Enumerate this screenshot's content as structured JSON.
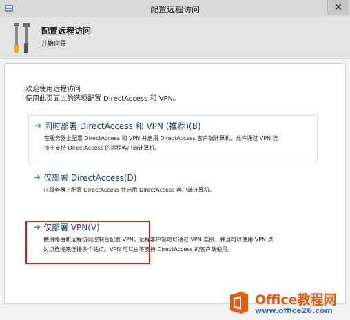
{
  "window": {
    "title": "配置远程访问"
  },
  "header": {
    "title": "配置远程访问",
    "subtitle": "开始向导"
  },
  "intro": {
    "line1": "欢迎使用远程访问",
    "line2": "使用此页面上的选项配置 DirectAccess 和 VPN。"
  },
  "options": [
    {
      "title": "同时部署 DirectAccess 和 VPN (推荐)(B)",
      "desc_line1": "在服务器上配置 DirectAccess 和 VPN 并启用 DirectAccess 客户端计算机。允许通过 VPN 连",
      "desc_line2": "接不支持 DirectAccess 的远程客户端计算机。"
    },
    {
      "title": "仅部署 DirectAccess(D)",
      "desc_line1": "在服务器上配置 DirectAccess 并启用 DirectAccess 客户端计算机。"
    },
    {
      "title": "仅部署 VPN(V)",
      "desc_line1": "使用路由和远程访问控制台配置 VPN。远程客户端可以通过 VPN 连接，并且可以使用 VPN 点",
      "desc_line2": "对点连接来连接多个站点。VPN 可以由不支持 DirectAccess 的客户端使用。"
    }
  ],
  "watermark": {
    "main": "Office教程网",
    "site": "www.office26.com"
  },
  "colors": {
    "arrow": "#2f8f2f",
    "option_title": "#1f3b63",
    "highlight": "#e01515"
  }
}
